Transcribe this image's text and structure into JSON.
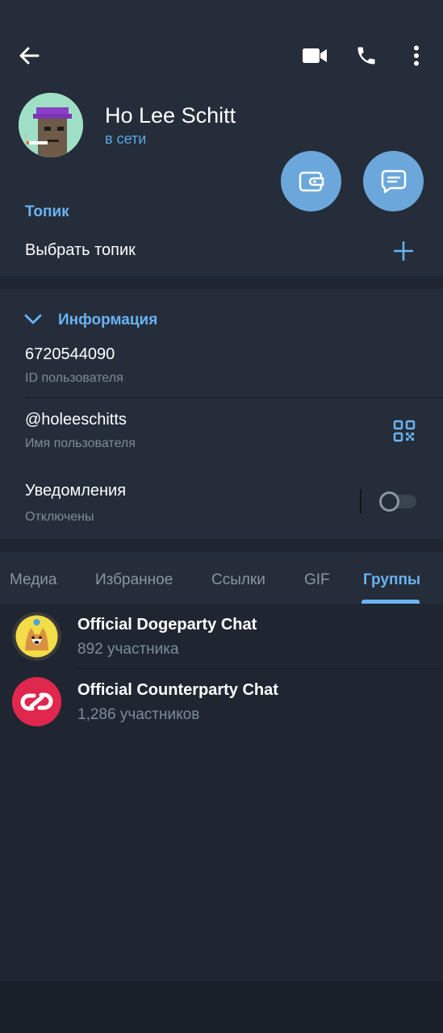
{
  "profile": {
    "name": "Ho Lee Schitt",
    "status": "в сети"
  },
  "topic": {
    "title": "Топик",
    "select_label": "Выбрать топик"
  },
  "info": {
    "title": "Информация",
    "user_id": "6720544090",
    "user_id_label": "ID пользователя",
    "username": "@holeeschitts",
    "username_label": "Имя пользователя",
    "notifications": "Уведомления",
    "notifications_state": "Отключены",
    "notifications_enabled": false
  },
  "tabs": [
    "Медиа",
    "Избранное",
    "Ссылки",
    "GIF",
    "Группы"
  ],
  "active_tab": "Группы",
  "groups": [
    {
      "name": "Official Dogeparty Chat",
      "members": "892 участника"
    },
    {
      "name": "Official Counterparty Chat",
      "members": "1,286 участников"
    }
  ],
  "icons": {
    "back": "arrow-left-icon",
    "video": "video-camera-icon",
    "call": "phone-icon",
    "menu": "more-vertical-icon",
    "wallet": "wallet-icon",
    "message": "message-icon",
    "add": "plus-icon",
    "info_toggle": "chevron-down-icon",
    "qr": "qr-code-icon"
  },
  "colors": {
    "accent": "#6ab3f3",
    "fab": "#6ba7da",
    "online": "#5aa7e8",
    "background": "#1f2631",
    "panel": "#242d39"
  }
}
